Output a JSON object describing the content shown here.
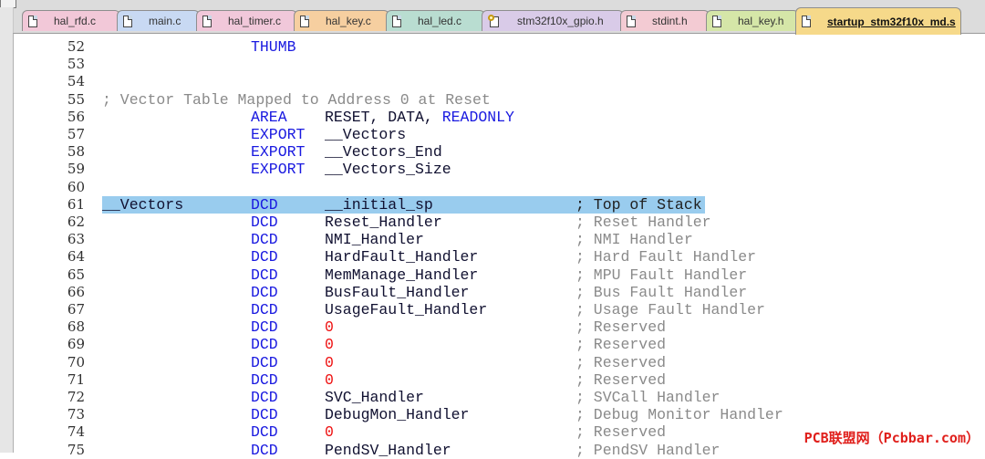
{
  "tabs": [
    {
      "label": "hal_rfd.c",
      "bg": "#f2c8d8",
      "icon": "file-icon"
    },
    {
      "label": "main.c",
      "bg": "#c8d9f3",
      "icon": "file-icon"
    },
    {
      "label": "hal_timer.c",
      "bg": "#f1c8da",
      "icon": "file-icon"
    },
    {
      "label": "hal_key.c",
      "bg": "#f6cfa0",
      "icon": "file-icon"
    },
    {
      "label": "hal_led.c",
      "bg": "#b9ddd1",
      "icon": "file-icon"
    },
    {
      "label": "stm32f10x_gpio.h",
      "bg": "#d9cbe8",
      "icon": "gpio-file-icon"
    },
    {
      "label": "stdint.h",
      "bg": "#f3cbd3",
      "icon": "file-icon"
    },
    {
      "label": "hal_key.h",
      "bg": "#d5e6a8",
      "icon": "file-icon"
    },
    {
      "label": "startup_stm32f10x_md.s",
      "bg": "#f6d98a",
      "icon": "file-icon",
      "active": true
    }
  ],
  "lines": [
    {
      "n": "52",
      "dir": "THUMB"
    },
    {
      "n": "53"
    },
    {
      "n": "54"
    },
    {
      "n": "55",
      "full": "; Vector Table Mapped to Address 0 at Reset"
    },
    {
      "n": "56",
      "dir": "AREA",
      "op": "RESET, DATA, ",
      "kw": "READONLY"
    },
    {
      "n": "57",
      "dir": "EXPORT",
      "op": "__Vectors"
    },
    {
      "n": "58",
      "dir": "EXPORT",
      "op": "__Vectors_End"
    },
    {
      "n": "59",
      "dir": "EXPORT",
      "op": "__Vectors_Size"
    },
    {
      "n": "60"
    },
    {
      "n": "61",
      "label": "__Vectors",
      "dir": "DCD",
      "op": "__initial_sp",
      "cmt": "; Top of Stack",
      "hl": true
    },
    {
      "n": "62",
      "dir": "DCD",
      "op": "Reset_Handler",
      "cmt": "; Reset Handler"
    },
    {
      "n": "63",
      "dir": "DCD",
      "op": "NMI_Handler",
      "cmt": "; NMI Handler"
    },
    {
      "n": "64",
      "dir": "DCD",
      "op": "HardFault_Handler",
      "cmt": "; Hard Fault Handler"
    },
    {
      "n": "65",
      "dir": "DCD",
      "op": "MemManage_Handler",
      "cmt": "; MPU Fault Handler"
    },
    {
      "n": "66",
      "dir": "DCD",
      "op": "BusFault_Handler",
      "cmt": "; Bus Fault Handler"
    },
    {
      "n": "67",
      "dir": "DCD",
      "op": "UsageFault_Handler",
      "cmt": "; Usage Fault Handler"
    },
    {
      "n": "68",
      "dir": "DCD",
      "op": "0",
      "num": true,
      "cmt": "; Reserved"
    },
    {
      "n": "69",
      "dir": "DCD",
      "op": "0",
      "num": true,
      "cmt": "; Reserved"
    },
    {
      "n": "70",
      "dir": "DCD",
      "op": "0",
      "num": true,
      "cmt": "; Reserved"
    },
    {
      "n": "71",
      "dir": "DCD",
      "op": "0",
      "num": true,
      "cmt": "; Reserved"
    },
    {
      "n": "72",
      "dir": "DCD",
      "op": "SVC_Handler",
      "cmt": "; SVCall Handler"
    },
    {
      "n": "73",
      "dir": "DCD",
      "op": "DebugMon_Handler",
      "cmt": "; Debug Monitor Handler"
    },
    {
      "n": "74",
      "dir": "DCD",
      "op": "0",
      "num": true,
      "cmt": "; Reserved"
    },
    {
      "n": "75",
      "dir": "DCD",
      "op": "PendSV_Handler",
      "cmt": "; PendSV Handler"
    }
  ],
  "watermark": "PCB联盟网（Pcbbar.com）"
}
